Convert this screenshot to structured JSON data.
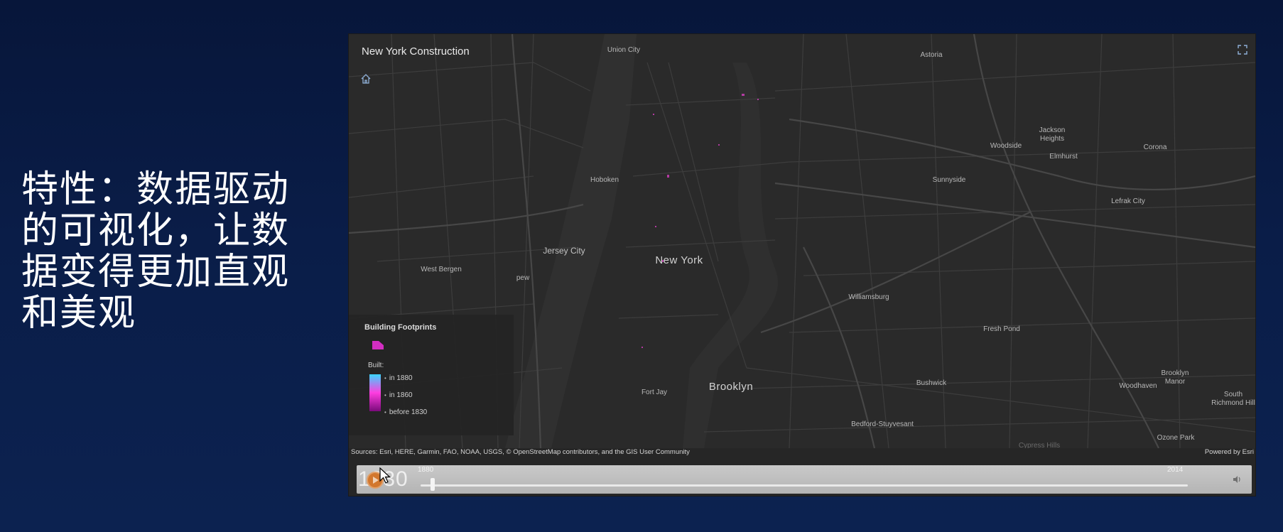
{
  "slide": {
    "text": "特性：数据驱动的可视化，让数据变得更加直观和美观"
  },
  "map": {
    "title": "New York Construction",
    "places": {
      "union_city": "Union City",
      "astoria": "Astoria",
      "hoboken": "Hoboken",
      "jersey_city": "Jersey City",
      "west_bergen": "West Bergen",
      "pew": "pew",
      "new_york": "New York",
      "woodside": "Woodside",
      "jackson_heights": "Jackson\nHeights",
      "elmhurst": "Elmhurst",
      "corona": "Corona",
      "sunnyside": "Sunnyside",
      "lefrak_city": "Lefrak City",
      "williamsburg": "Williamsburg",
      "fresh_pond": "Fresh Pond",
      "fort_jay": "Fort Jay",
      "brooklyn": "Brooklyn",
      "bushwick": "Bushwick",
      "bedford_stuyvesant": "Bedford-Stuyvesant",
      "woodhaven": "Woodhaven",
      "brooklyn_manor": "Brooklyn\nManor",
      "south_richmond_hill": "South\nRichmond Hill",
      "ozone_park": "Ozone Park",
      "cypress_hills": "Cypress Hills"
    },
    "legend": {
      "title": "Building Footprints",
      "built_label": "Built:",
      "stops": [
        "in 1880",
        "in 1860",
        "before 1830"
      ],
      "ramp_colors": [
        "#3ad7ff",
        "#ff3de0",
        "#7a0a7a"
      ]
    },
    "attribution": "Sources: Esri, HERE, Garmin, FAO, NOAA, USGS, © OpenStreetMap contributors, and the GIS User Community",
    "powered_by": "Powered by Esri",
    "icons": {
      "home": "home-icon",
      "expand": "expand-icon"
    }
  },
  "time_slider": {
    "current_year": "1830",
    "start_label": "1880",
    "end_label": "2014",
    "progress_fraction": 0.014,
    "play_icon": "play-icon",
    "volume_icon": "volume-icon",
    "accent_color": "#d2772e"
  },
  "colors": {
    "background": "#0a1d48",
    "map_base": "#2a2a2a",
    "building_highlight": "#ff3de0"
  }
}
